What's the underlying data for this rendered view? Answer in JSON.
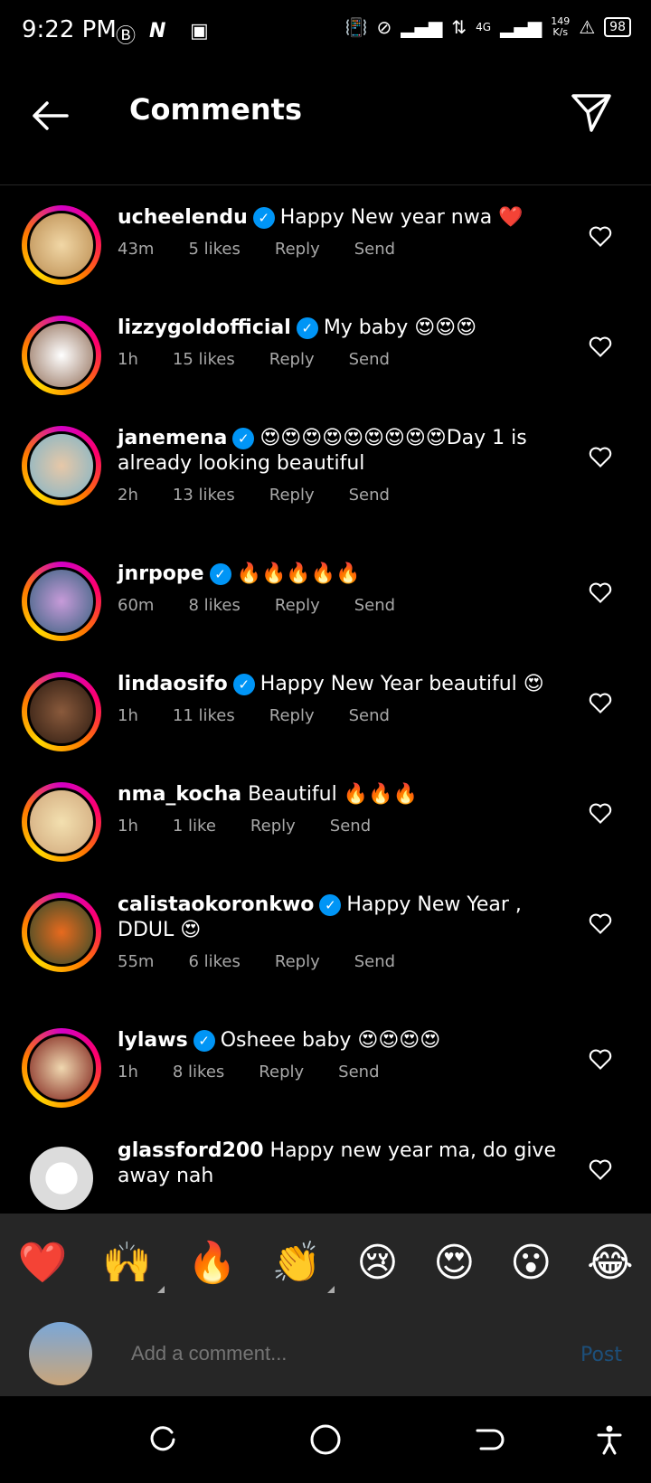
{
  "status": {
    "time": "9:22 PM",
    "speed_top": "149",
    "speed_bottom": "K/s",
    "battery": "98",
    "network": "4G"
  },
  "header": {
    "title": "Comments"
  },
  "comments": [
    {
      "user": "ucheelendu",
      "verified": true,
      "text": "Happy New year nwa ❤️",
      "time": "43m",
      "likes": "5 likes",
      "reply": "Reply",
      "send": "Send"
    },
    {
      "user": "lizzygoldofficial",
      "verified": true,
      "text": "My baby 😍😍😍",
      "time": "1h",
      "likes": "15 likes",
      "reply": "Reply",
      "send": "Send"
    },
    {
      "user": "janemena",
      "verified": true,
      "text": "😍😍😍😍😍😍😍😍😍Day 1 is already looking beautiful",
      "time": "2h",
      "likes": "13 likes",
      "reply": "Reply",
      "send": "Send"
    },
    {
      "user": "jnrpope",
      "verified": true,
      "text": "🔥🔥🔥🔥🔥",
      "time": "60m",
      "likes": "8 likes",
      "reply": "Reply",
      "send": "Send"
    },
    {
      "user": "lindaosifo",
      "verified": true,
      "text": "Happy New Year beautiful 😍",
      "time": "1h",
      "likes": "11 likes",
      "reply": "Reply",
      "send": "Send"
    },
    {
      "user": "nma_kocha",
      "verified": false,
      "text": "Beautiful 🔥🔥🔥",
      "time": "1h",
      "likes": "1 like",
      "reply": "Reply",
      "send": "Send"
    },
    {
      "user": "calistaokoronkwo",
      "verified": true,
      "text": "Happy New Year , DDUL 😍",
      "time": "55m",
      "likes": "6 likes",
      "reply": "Reply",
      "send": "Send"
    },
    {
      "user": "lylaws",
      "verified": true,
      "text": "Osheee baby 😍😍😍😍",
      "time": "1h",
      "likes": "8 likes",
      "reply": "Reply",
      "send": "Send"
    },
    {
      "user": "glassford200",
      "verified": false,
      "text": "Happy new year ma, do give away nah",
      "time": "",
      "likes": "",
      "reply": "",
      "send": ""
    }
  ],
  "reactions": [
    "❤️",
    "🙌",
    "🔥",
    "👏",
    "😢",
    "😍",
    "😮",
    "😂"
  ],
  "composer": {
    "placeholder": "Add a comment...",
    "post_label": "Post"
  },
  "colors": {
    "accent_blue": "#0095f6",
    "muted": "#a8a8a8",
    "panel": "#262626"
  }
}
